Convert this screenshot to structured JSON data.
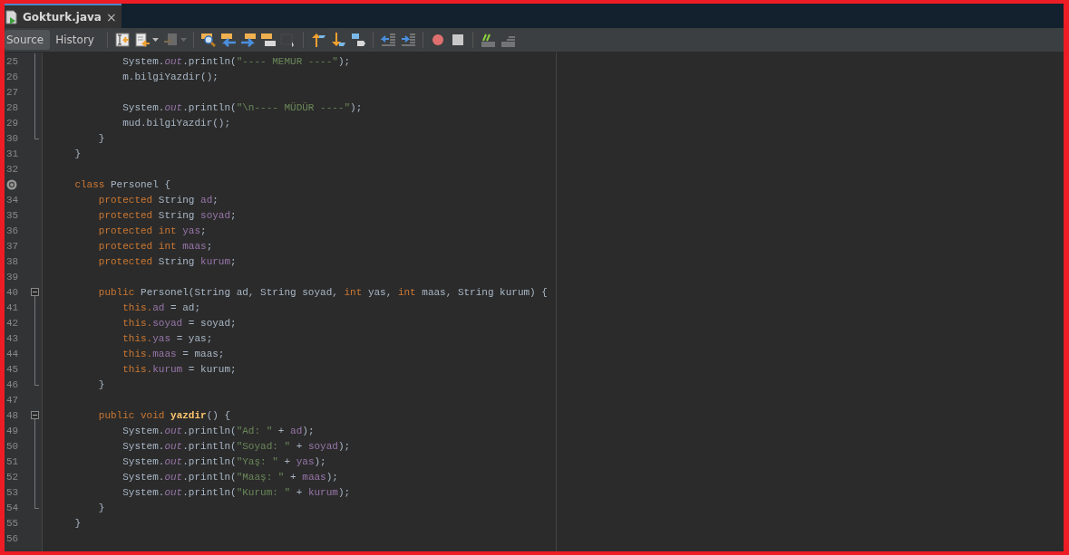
{
  "tabs": [
    {
      "title": "Gokturk.java",
      "selected": true,
      "close": "×"
    }
  ],
  "view_tabs": [
    {
      "label": "Source",
      "selected": true
    },
    {
      "label": "History",
      "selected": false
    }
  ],
  "toolbar": [
    {
      "kind": "bookmark"
    },
    {
      "kind": "recent",
      "dropdown": true
    },
    {
      "kind": "disabled-doc",
      "dropdown": true
    },
    {
      "kind": "sep"
    },
    {
      "kind": "find"
    },
    {
      "kind": "prev"
    },
    {
      "kind": "next"
    },
    {
      "kind": "highlight"
    },
    {
      "kind": "select-disabled"
    },
    {
      "kind": "sep"
    },
    {
      "kind": "shift-up"
    },
    {
      "kind": "shift-down"
    },
    {
      "kind": "shift-right"
    },
    {
      "kind": "sep"
    },
    {
      "kind": "unindent"
    },
    {
      "kind": "indent"
    },
    {
      "kind": "sep"
    },
    {
      "kind": "record"
    },
    {
      "kind": "stop"
    },
    {
      "kind": "sep"
    },
    {
      "kind": "comment"
    },
    {
      "kind": "uncomment"
    }
  ],
  "lines": [
    {
      "number": "25",
      "kind": "fold-inside",
      "tokens": [
        {
          "kind": "plain",
          "text": "            System."
        },
        {
          "kind": "static",
          "text": "out"
        },
        {
          "kind": "plain",
          "text": ".println("
        },
        {
          "kind": "string",
          "text": "\"---- MEMUR ----\""
        },
        {
          "kind": "plain",
          "text": ");"
        }
      ]
    },
    {
      "number": "26",
      "kind": "fold-inside",
      "tokens": [
        {
          "kind": "plain",
          "text": "            m.bilgiYazdir();"
        }
      ]
    },
    {
      "number": "27",
      "kind": "fold-inside"
    },
    {
      "number": "28",
      "kind": "fold-inside",
      "tokens": [
        {
          "kind": "plain",
          "text": "            System."
        },
        {
          "kind": "static",
          "text": "out"
        },
        {
          "kind": "plain",
          "text": ".println("
        },
        {
          "kind": "string",
          "text": "\"\\n---- MÜDÜR ----\""
        },
        {
          "kind": "plain",
          "text": ");"
        }
      ]
    },
    {
      "number": "29",
      "kind": "fold-inside",
      "tokens": [
        {
          "kind": "plain",
          "text": "            mud.bilgiYazdir();"
        }
      ]
    },
    {
      "number": "30",
      "kind": "fold-end",
      "tokens": [
        {
          "kind": "plain",
          "text": "        }"
        }
      ]
    },
    {
      "number": "31",
      "kind": "plain",
      "tokens": [
        {
          "kind": "plain",
          "text": "    }"
        }
      ]
    },
    {
      "number": "32",
      "kind": "plain"
    },
    {
      "kind": "override",
      "tokens": [
        {
          "kind": "keyword",
          "text": "    class "
        },
        {
          "kind": "plain",
          "text": "Personel {"
        }
      ]
    },
    {
      "number": "34",
      "kind": "plain",
      "tokens": [
        {
          "kind": "keyword",
          "text": "        protected "
        },
        {
          "kind": "plain",
          "text": "String "
        },
        {
          "kind": "field",
          "text": "ad"
        },
        {
          "kind": "plain",
          "text": ";"
        }
      ]
    },
    {
      "number": "35",
      "kind": "plain",
      "tokens": [
        {
          "kind": "keyword",
          "text": "        protected "
        },
        {
          "kind": "plain",
          "text": "String "
        },
        {
          "kind": "field",
          "text": "soyad"
        },
        {
          "kind": "plain",
          "text": ";"
        }
      ]
    },
    {
      "number": "36",
      "kind": "plain",
      "tokens": [
        {
          "kind": "keyword",
          "text": "        protected int "
        },
        {
          "kind": "field",
          "text": "yas"
        },
        {
          "kind": "plain",
          "text": ";"
        }
      ]
    },
    {
      "number": "37",
      "kind": "plain",
      "tokens": [
        {
          "kind": "keyword",
          "text": "        protected int "
        },
        {
          "kind": "field",
          "text": "maas"
        },
        {
          "kind": "plain",
          "text": ";"
        }
      ]
    },
    {
      "number": "38",
      "kind": "plain",
      "tokens": [
        {
          "kind": "keyword",
          "text": "        protected "
        },
        {
          "kind": "plain",
          "text": "String "
        },
        {
          "kind": "field",
          "text": "kurum"
        },
        {
          "kind": "plain",
          "text": ";"
        }
      ]
    },
    {
      "number": "39",
      "kind": "plain"
    },
    {
      "number": "40",
      "kind": "fold-start",
      "tokens": [
        {
          "kind": "keyword",
          "text": "        public "
        },
        {
          "kind": "plain",
          "text": "Personel(String ad, String soyad, "
        },
        {
          "kind": "keyword",
          "text": "int "
        },
        {
          "kind": "plain",
          "text": "yas, "
        },
        {
          "kind": "keyword",
          "text": "int "
        },
        {
          "kind": "plain",
          "text": "maas, String kurum) {"
        }
      ]
    },
    {
      "number": "41",
      "kind": "fold-inside",
      "tokens": [
        {
          "kind": "keyword",
          "text": "            this."
        },
        {
          "kind": "field",
          "text": "ad"
        },
        {
          "kind": "plain",
          "text": " = ad;"
        }
      ]
    },
    {
      "number": "42",
      "kind": "fold-inside",
      "tokens": [
        {
          "kind": "keyword",
          "text": "            this."
        },
        {
          "kind": "field",
          "text": "soyad"
        },
        {
          "kind": "plain",
          "text": " = soyad;"
        }
      ]
    },
    {
      "number": "43",
      "kind": "fold-inside",
      "tokens": [
        {
          "kind": "keyword",
          "text": "            this."
        },
        {
          "kind": "field",
          "text": "yas"
        },
        {
          "kind": "plain",
          "text": " = yas;"
        }
      ]
    },
    {
      "number": "44",
      "kind": "fold-inside",
      "tokens": [
        {
          "kind": "keyword",
          "text": "            this."
        },
        {
          "kind": "field",
          "text": "maas"
        },
        {
          "kind": "plain",
          "text": " = maas;"
        }
      ]
    },
    {
      "number": "45",
      "kind": "fold-inside",
      "tokens": [
        {
          "kind": "keyword",
          "text": "            this."
        },
        {
          "kind": "field",
          "text": "kurum"
        },
        {
          "kind": "plain",
          "text": " = kurum;"
        }
      ]
    },
    {
      "number": "46",
      "kind": "fold-end",
      "tokens": [
        {
          "kind": "plain",
          "text": "        }"
        }
      ]
    },
    {
      "number": "47",
      "kind": "plain"
    },
    {
      "number": "48",
      "kind": "fold-start",
      "tokens": [
        {
          "kind": "keyword",
          "text": "        public void "
        },
        {
          "kind": "method",
          "text": "yazdir"
        },
        {
          "kind": "plain",
          "text": "() {"
        }
      ]
    },
    {
      "number": "49",
      "kind": "fold-inside",
      "tokens": [
        {
          "kind": "plain",
          "text": "            System."
        },
        {
          "kind": "static",
          "text": "out"
        },
        {
          "kind": "plain",
          "text": ".println("
        },
        {
          "kind": "string",
          "text": "\"Ad: \""
        },
        {
          "kind": "plain",
          "text": " + "
        },
        {
          "kind": "field",
          "text": "ad"
        },
        {
          "kind": "plain",
          "text": ");"
        }
      ]
    },
    {
      "number": "50",
      "kind": "fold-inside",
      "tokens": [
        {
          "kind": "plain",
          "text": "            System."
        },
        {
          "kind": "static",
          "text": "out"
        },
        {
          "kind": "plain",
          "text": ".println("
        },
        {
          "kind": "string",
          "text": "\"Soyad: \""
        },
        {
          "kind": "plain",
          "text": " + "
        },
        {
          "kind": "field",
          "text": "soyad"
        },
        {
          "kind": "plain",
          "text": ");"
        }
      ]
    },
    {
      "number": "51",
      "kind": "fold-inside",
      "tokens": [
        {
          "kind": "plain",
          "text": "            System."
        },
        {
          "kind": "static",
          "text": "out"
        },
        {
          "kind": "plain",
          "text": ".println("
        },
        {
          "kind": "string",
          "text": "\"Yaş: \""
        },
        {
          "kind": "plain",
          "text": " + "
        },
        {
          "kind": "field",
          "text": "yas"
        },
        {
          "kind": "plain",
          "text": ");"
        }
      ]
    },
    {
      "number": "52",
      "kind": "fold-inside",
      "tokens": [
        {
          "kind": "plain",
          "text": "            System."
        },
        {
          "kind": "static",
          "text": "out"
        },
        {
          "kind": "plain",
          "text": ".println("
        },
        {
          "kind": "string",
          "text": "\"Maaş: \""
        },
        {
          "kind": "plain",
          "text": " + "
        },
        {
          "kind": "field",
          "text": "maas"
        },
        {
          "kind": "plain",
          "text": ");"
        }
      ]
    },
    {
      "number": "53",
      "kind": "fold-inside",
      "tokens": [
        {
          "kind": "plain",
          "text": "            System."
        },
        {
          "kind": "static",
          "text": "out"
        },
        {
          "kind": "plain",
          "text": ".println("
        },
        {
          "kind": "string",
          "text": "\"Kurum: \""
        },
        {
          "kind": "plain",
          "text": " + "
        },
        {
          "kind": "field",
          "text": "kurum"
        },
        {
          "kind": "plain",
          "text": ");"
        }
      ]
    },
    {
      "number": "54",
      "kind": "fold-end",
      "tokens": [
        {
          "kind": "plain",
          "text": "        }"
        }
      ]
    },
    {
      "number": "55",
      "kind": "plain",
      "tokens": [
        {
          "kind": "plain",
          "text": "    }"
        }
      ]
    },
    {
      "number": "56",
      "kind": "plain"
    }
  ]
}
